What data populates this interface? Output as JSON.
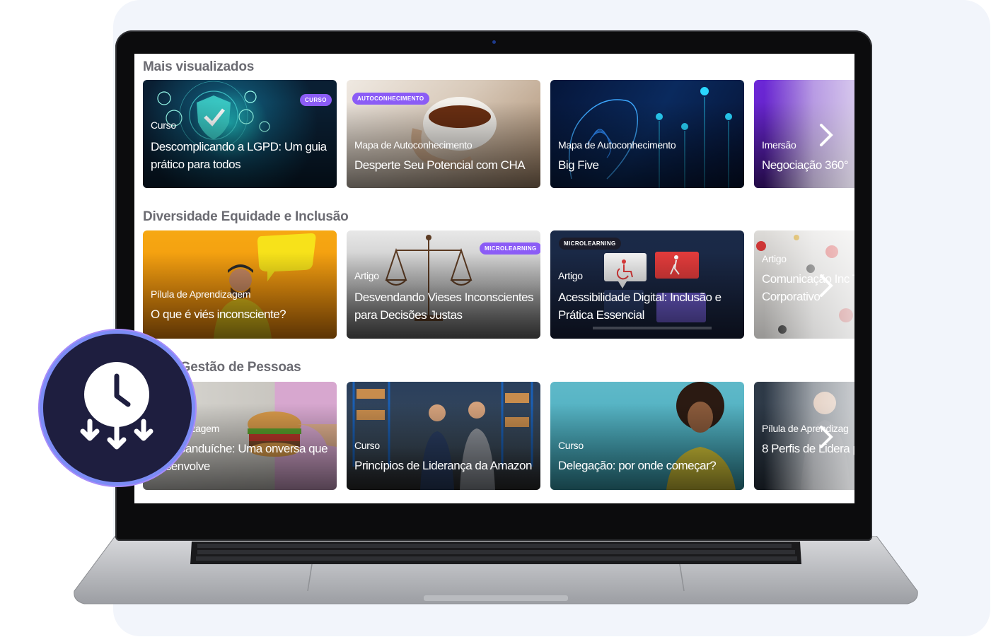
{
  "sections": [
    {
      "title": "Mais visualizados",
      "cards": [
        {
          "type": "Curso",
          "title": "Descomplicando a LGPD: Um guia prático para todos",
          "badge": "CURSO"
        },
        {
          "type": "Mapa de Autoconhecimento",
          "title": "Desperte Seu Potencial com CHA",
          "badge": "AUTOCONHECIMENTO"
        },
        {
          "type": "Mapa de Autoconhecimento",
          "title": "Big Five",
          "badge": ""
        },
        {
          "type": "Imersão",
          "title": "Negociação 360°",
          "badge": ""
        }
      ]
    },
    {
      "title": "Diversidade Equidade e Inclusão",
      "cards": [
        {
          "type": "Pílula de Aprendizagem",
          "title": "O que é viés inconsciente?",
          "badge": ""
        },
        {
          "type": "Artigo",
          "title": "Desvendando Vieses Inconscientes para Decisões Justas",
          "badge": "MICROLEARNING"
        },
        {
          "type": "Artigo",
          "title": "Acessibilidade Digital: Inclusão e Prática Essencial",
          "badge": "MICROLEARNING"
        },
        {
          "type": "Artigo",
          "title": "Comunicação Inc Transforme Seu A Corporativo",
          "badge": ""
        }
      ]
    },
    {
      "title": "nça e Gestão de Pessoas",
      "cards": [
        {
          "type": "e Aprendizagem",
          "title": "back Sanduíche: Uma onversa que Desenvolve",
          "badge": ""
        },
        {
          "type": "Curso",
          "title": "Princípios de Liderança da Amazon",
          "badge": ""
        },
        {
          "type": "Curso",
          "title": "Delegação: por onde começar?",
          "badge": ""
        },
        {
          "type": "Pílula de Aprendizag",
          "title": "8 Perfis de Lidera prática",
          "badge": ""
        }
      ]
    }
  ],
  "icons": {
    "next": "chevron-right-icon",
    "badge": "clock-download-icon"
  },
  "colors": {
    "badge_purple": "#8b5cf6",
    "badge_dark": "#1c1c2a",
    "clock_badge_bg": "#1e1e3f",
    "clock_badge_ring": "#7c8cf5",
    "section_title": "#6b6b72"
  }
}
